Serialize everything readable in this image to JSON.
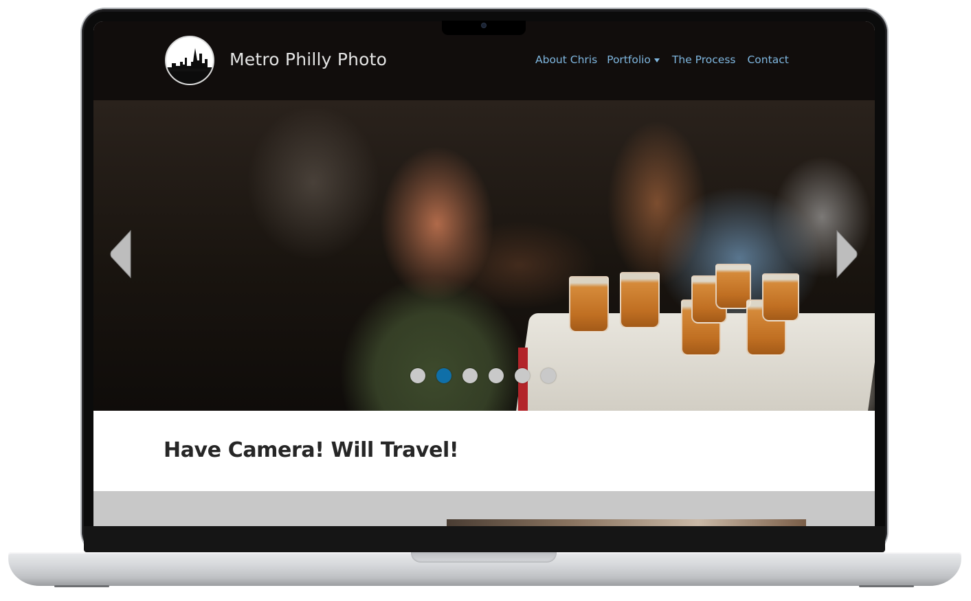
{
  "site": {
    "title": "Metro Philly Photo",
    "logo_icon": "skyline-logo-icon"
  },
  "nav": {
    "items": [
      {
        "label": "About Chris"
      },
      {
        "label": "Portfolio",
        "has_dropdown": true
      },
      {
        "label": "The Process"
      },
      {
        "label": "Contact"
      }
    ]
  },
  "slider": {
    "prev_icon": "chevron-left-icon",
    "next_icon": "chevron-right-icon",
    "slide_count": 6,
    "active_index": 1
  },
  "intro": {
    "heading": "Have Camera! Will Travel!"
  },
  "colors": {
    "header_bg": "#110d0c",
    "nav_link": "#7fb7e0",
    "active_dot": "#0f6fa8",
    "section_gray": "#c8c8c8"
  }
}
